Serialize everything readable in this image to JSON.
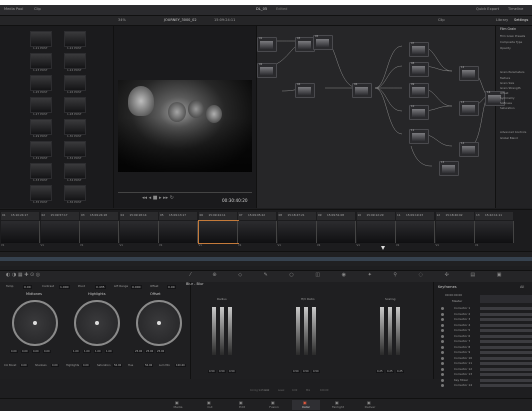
{
  "titlebar": {
    "media_pool": "Media Pool",
    "clip": "Clip",
    "project_title": "DL_05",
    "edited": "Edited",
    "quick_export": "Quick Export",
    "timeline_label": "Timeline"
  },
  "viewer": {
    "zoom": "34%",
    "clip_name": "JOURNEY_3000_02",
    "timecode_top": "15:09:24:11",
    "clip_label": "Clip",
    "timecode_main": "00:30:40:20"
  },
  "node_editor": {
    "nodes": [
      {
        "label": "01"
      },
      {
        "label": "02"
      },
      {
        "label": "03"
      },
      {
        "label": "04"
      },
      {
        "label": "05"
      },
      {
        "label": "06"
      },
      {
        "label": "07"
      },
      {
        "label": "08"
      },
      {
        "label": "09"
      },
      {
        "label": "10"
      },
      {
        "label": "11"
      },
      {
        "label": "12"
      },
      {
        "label": "13"
      },
      {
        "label": "14"
      },
      {
        "label": "15"
      },
      {
        "label": "16"
      }
    ]
  },
  "settings_panel": {
    "tabs": [
      "Library",
      "Settings"
    ],
    "film_grain": "Film Grain",
    "items": [
      "Film Grain Presets",
      "Composite Type",
      "Opacity",
      "Grain Parameters",
      "Texture",
      "Grain Size",
      "Grain Strength",
      "Offset",
      "Symmetry",
      "Softness",
      "Saturation",
      "Advanced Controls",
      "Global Blend"
    ]
  },
  "thumbnails": [
    "1.21 POST",
    "1.22 POST",
    "1.23 POST",
    "1.24 POST",
    "1.25 POST",
    "1.26 POST",
    "1.27 POST",
    "1.28 POST",
    "1.29 POST",
    "1.30 POST",
    "1.31 POST",
    "1.32 POST",
    "1.33 POST",
    "1.34 POST",
    "1.35 POST",
    "1.36 POST"
  ],
  "timeline": {
    "clips": [
      {
        "num": "01",
        "tc": "15:10:24:17",
        "trk": "V1"
      },
      {
        "num": "02",
        "tc": "15:09:57:17",
        "trk": "V1"
      },
      {
        "num": "03",
        "tc": "15:09:24:18",
        "trk": "V1"
      },
      {
        "num": "04",
        "tc": "15:09:18:14",
        "trk": "V1"
      },
      {
        "num": "05",
        "tc": "15:09:13:17",
        "trk": "V1"
      },
      {
        "num": "06",
        "tc": "15:09:24:11",
        "trk": "V1"
      },
      {
        "num": "07",
        "tc": "15:09:05:22",
        "trk": "V1"
      },
      {
        "num": "08",
        "tc": "15:18:47:21",
        "trk": "V1"
      },
      {
        "num": "09",
        "tc": "15:09:51:08",
        "trk": "V1"
      },
      {
        "num": "10",
        "tc": "15:09:12:29",
        "trk": "V1"
      },
      {
        "num": "11",
        "tc": "15:09:19:23",
        "trk": "V1"
      },
      {
        "num": "12",
        "tc": "15:18:40:02",
        "trk": "V1"
      },
      {
        "num": "13",
        "tc": "15:22:11:11",
        "trk": "V1"
      }
    ]
  },
  "color_panel": {
    "top_fields": [
      {
        "label": "Temp",
        "value": "0.00"
      },
      {
        "label": "Contrast",
        "value": "1.000"
      },
      {
        "label": "Pivot",
        "value": "0.435"
      },
      {
        "label": "Lift Range",
        "value": "0.000"
      },
      {
        "label": "Offset",
        "value": "0.00"
      }
    ],
    "wheels": [
      {
        "name": "Midtones",
        "values": [
          "0.00",
          "0.00",
          "0.00",
          "0.00"
        ]
      },
      {
        "name": "Highlights",
        "values": [
          "1.00",
          "1.00",
          "1.00",
          "1.00"
        ]
      },
      {
        "name": "Offset",
        "values": [
          "25.00",
          "25.00",
          "25.00"
        ]
      }
    ],
    "bottom_fields": [
      {
        "label": "Col Boost",
        "value": "0.00"
      },
      {
        "label": "Shadows",
        "value": "0.00"
      },
      {
        "label": "Highlights",
        "value": "0.00"
      },
      {
        "label": "Saturation",
        "value": "50.00"
      },
      {
        "label": "Hue",
        "value": "50.00"
      },
      {
        "label": "Lum Mix",
        "value": "100.00"
      }
    ]
  },
  "blur_panel": {
    "title": "Blur - Blur",
    "groups": [
      {
        "name": "Radius",
        "values": [
          "0.50",
          "0.50",
          "0.50"
        ]
      },
      {
        "name": "H/V Ratio",
        "values": [
          "0.50",
          "0.50",
          "0.50"
        ]
      },
      {
        "name": "Scaling",
        "values": [
          "0.25",
          "0.25",
          "0.25"
        ]
      }
    ],
    "footer": [
      "Coring Softness",
      "0.00",
      "Level",
      "0.00",
      "Mix",
      "100.00"
    ]
  },
  "keyframes": {
    "title": "Keyframes",
    "mode": "All",
    "master": "Master",
    "timecode": "00:00:00:00",
    "rows": [
      "Corrector 1",
      "Corrector 2",
      "Corrector 3",
      "Corrector 4",
      "Corrector 5",
      "Corrector 6",
      "Corrector 7",
      "Corrector 8",
      "Corrector 9",
      "Corrector 10",
      "Corrector 11",
      "Corrector 12",
      "Corrector 13",
      "Key Mixer",
      "Corrector 14"
    ]
  },
  "pages": [
    "Media",
    "Cut",
    "Edit",
    "Fusion",
    "Color",
    "Fairlight",
    "Deliver"
  ],
  "active_page": "Color"
}
